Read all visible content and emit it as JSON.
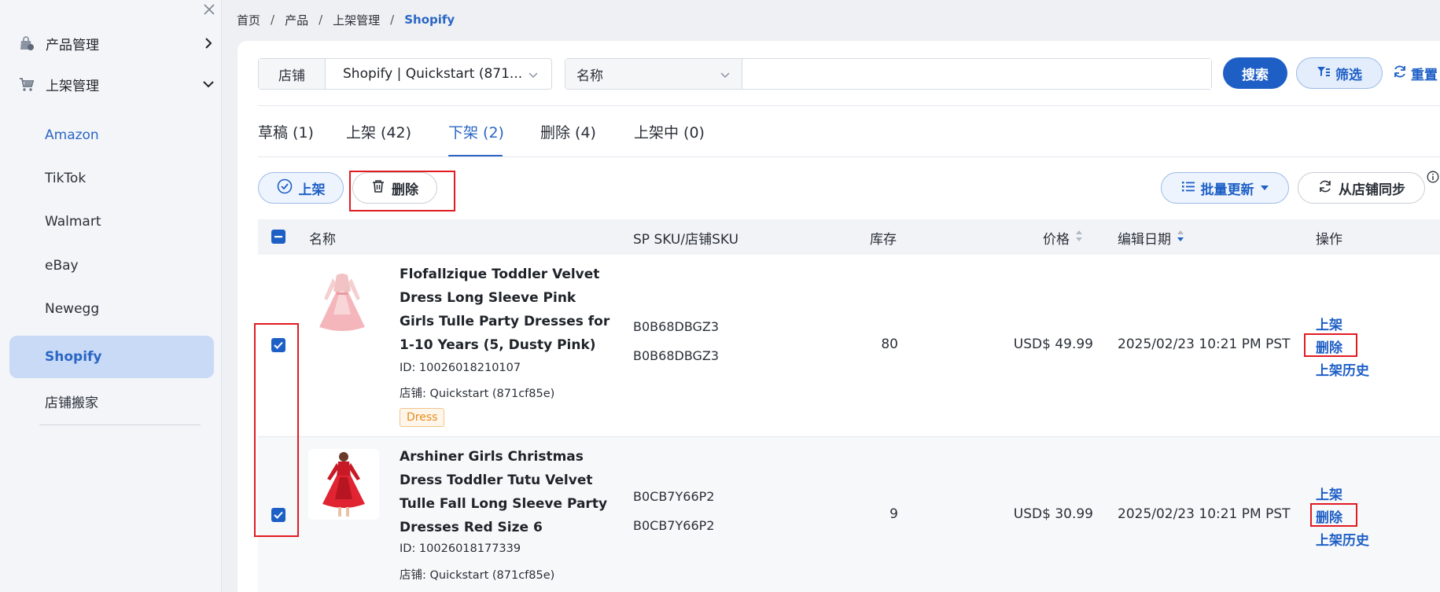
{
  "sidebar": {
    "close_icon": "close-icon",
    "groups": [
      {
        "label": "产品管理",
        "icon": "product-bag-icon",
        "arrow": "chevron-right-icon"
      },
      {
        "label": "上架管理",
        "icon": "cart-icon",
        "arrow": "chevron-down-icon"
      }
    ],
    "items": [
      {
        "label": "Amazon"
      },
      {
        "label": "TikTok"
      },
      {
        "label": "Walmart"
      },
      {
        "label": "eBay"
      },
      {
        "label": "Newegg"
      },
      {
        "label": "Shopify"
      },
      {
        "label": "店铺搬家"
      }
    ],
    "active_item": "Shopify"
  },
  "breadcrumb": {
    "items": [
      "首页",
      "产品",
      "上架管理",
      "Shopify"
    ],
    "separator": "/"
  },
  "search": {
    "store_label": "店铺",
    "store_value": "Shopify | Quickstart (871...",
    "field_value": "名称",
    "input_value": "",
    "search_button": "搜索",
    "filter_button": "筛选",
    "reset_button": "重置"
  },
  "tabs": [
    {
      "label": "草稿 (1)"
    },
    {
      "label": "上架 (42)"
    },
    {
      "label": "下架 (2)"
    },
    {
      "label": "删除 (4)"
    },
    {
      "label": "上架中 (0)"
    }
  ],
  "active_tab": "下架 (2)",
  "actions": {
    "onshelf_button": "上架",
    "delete_button": "删除",
    "bulk_update_button": "批量更新",
    "sync_button": "从店铺同步"
  },
  "table": {
    "headers": {
      "name": "名称",
      "sku": "SP SKU/店铺SKU",
      "stock": "库存",
      "price": "价格",
      "edit_date": "编辑日期",
      "ops": "操作"
    },
    "rows": [
      {
        "checked": true,
        "title": "Flofallzique Toddler Velvet Dress Long Sleeve Pink Girls Tulle Party Dresses for 1-10 Years (5, Dusty Pink)",
        "id": "ID: 10026018210107",
        "store": "店铺: Quickstart (871cf85e)",
        "tag": "Dress",
        "sp_sku": "B0B68DBGZ3",
        "store_sku": "B0B68DBGZ3",
        "stock": "80",
        "price": "USD$ 49.99",
        "date": "2025/02/23 10:21 PM PST",
        "ops": [
          "上架",
          "删除",
          "上架历史"
        ]
      },
      {
        "checked": true,
        "title": "Arshiner Girls Christmas Dress Toddler Tutu Velvet Tulle Fall Long Sleeve Party Dresses Red Size 6",
        "id": "ID: 10026018177339",
        "store": "店铺: Quickstart (871cf85e)",
        "sp_sku": "B0CB7Y66P2",
        "store_sku": "B0CB7Y66P2",
        "stock": "9",
        "price": "USD$ 30.99",
        "date": "2025/02/23 10:21 PM PST",
        "ops": [
          "上架",
          "删除",
          "上架历史"
        ]
      }
    ]
  },
  "colors": {
    "primary": "#1e5fc6",
    "highlight_box": "#e11b22",
    "sidebar_active_bg": "#c8daf6",
    "tag_orange": "#e88a1a"
  }
}
